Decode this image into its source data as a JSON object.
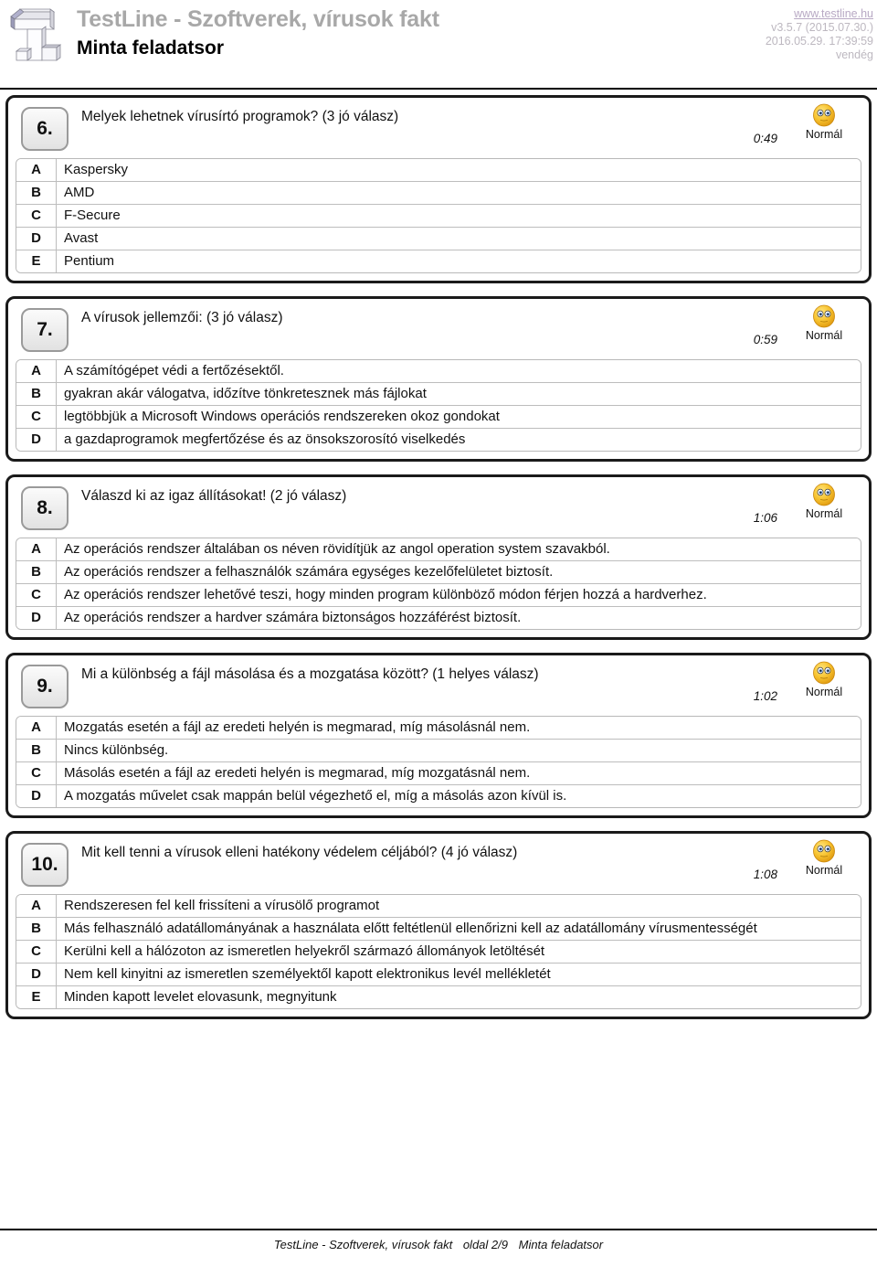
{
  "header": {
    "logo_icon": "isometric-t-block-logo",
    "site_title": "TestLine - Szoftverek, vírusok fakt",
    "doc_title": "Minta feladatsor",
    "site_url": "www.testline.hu",
    "version": "v3.5.7 (2015.07.30.)",
    "timestamp": "2016.05.29. 17:39:59",
    "user": "vendég"
  },
  "questions": [
    {
      "number": "6.",
      "text": "Melyek lehetnek vírusírtó programok? (3  jó válasz)",
      "time": "0:49",
      "level": "Normál",
      "level_icon": "neutral-smiley-icon",
      "answers": [
        {
          "letter": "A",
          "text": "Kaspersky"
        },
        {
          "letter": "B",
          "text": "AMD"
        },
        {
          "letter": "C",
          "text": "F-Secure"
        },
        {
          "letter": "D",
          "text": "Avast"
        },
        {
          "letter": "E",
          "text": "Pentium"
        }
      ]
    },
    {
      "number": "7.",
      "text": "A vírusok jellemzői: (3  jó válasz)",
      "time": "0:59",
      "level": "Normál",
      "level_icon": "neutral-smiley-icon",
      "answers": [
        {
          "letter": "A",
          "text": "A számítógépet védi a fertőzésektől."
        },
        {
          "letter": "B",
          "text": "gyakran akár válogatva, időzítve tönkretesznek más fájlokat"
        },
        {
          "letter": "C",
          "text": "legtöbbjük a Microsoft Windows operációs rendszereken okoz gondokat"
        },
        {
          "letter": "D",
          "text": "a gazdaprogramok megfertőzése és az önsokszorosító viselkedés"
        }
      ]
    },
    {
      "number": "8.",
      "text": "Válaszd ki az igaz állításokat! (2  jó válasz)",
      "time": "1:06",
      "level": "Normál",
      "level_icon": "neutral-smiley-icon",
      "answers": [
        {
          "letter": "A",
          "text": "Az operációs rendszer általában os néven rövidítjük az angol operation system szavakból."
        },
        {
          "letter": "B",
          "text": "Az operációs rendszer a felhasználók számára egységes kezelőfelületet biztosít."
        },
        {
          "letter": "C",
          "text": "Az operációs rendszer lehetővé teszi, hogy minden program különböző módon férjen hozzá a hardverhez."
        },
        {
          "letter": "D",
          "text": "Az operációs rendszer a hardver számára biztonságos hozzáférést biztosít."
        }
      ]
    },
    {
      "number": "9.",
      "text": "Mi a különbség a fájl másolása és a mozgatása között?  (1 helyes válasz)",
      "time": "1:02",
      "level": "Normál",
      "level_icon": "neutral-smiley-icon",
      "answers": [
        {
          "letter": "A",
          "text": "Mozgatás esetén a fájl az eredeti helyén is megmarad, míg másolásnál nem."
        },
        {
          "letter": "B",
          "text": "Nincs különbség."
        },
        {
          "letter": "C",
          "text": "Másolás esetén a fájl az eredeti helyén is megmarad, míg mozgatásnál nem."
        },
        {
          "letter": "D",
          "text": "A mozgatás művelet csak mappán belül végezhető el, míg a másolás azon kívül is."
        }
      ]
    },
    {
      "number": "10.",
      "text": "Mit kell tenni a vírusok elleni hatékony védelem céljából? (4  jó válasz)",
      "time": "1:08",
      "level": "Normál",
      "level_icon": "neutral-smiley-icon",
      "answers": [
        {
          "letter": "A",
          "text": "Rendszeresen fel kell frissíteni a vírusölő programot"
        },
        {
          "letter": "B",
          "text": "Más felhasználó adatállományának a használata előtt feltétlenül ellenőrizni kell az adatállomány vírusmentességét"
        },
        {
          "letter": "C",
          "text": "Kerülni kell a hálózoton az ismeretlen helyekről származó állományok letöltését"
        },
        {
          "letter": "D",
          "text": "Nem kell kinyitni az ismeretlen személyektől kapott elektronikus levél mellékletét"
        },
        {
          "letter": "E",
          "text": "Minden kapott levelet elovasunk, megnyitunk"
        }
      ]
    }
  ],
  "footer": {
    "left": "TestLine - Szoftverek, vírusok fakt",
    "page": "oldal 2/9",
    "right": "Minta feladatsor"
  },
  "colors": {
    "site_title": "#a8a8a8",
    "meta": "#bdb8c0",
    "border": "#1a1a1a",
    "smiley": "#f5c842"
  }
}
